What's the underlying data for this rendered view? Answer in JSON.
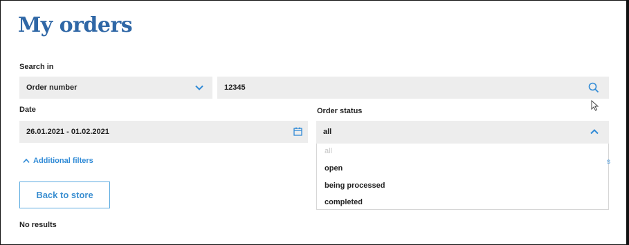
{
  "page": {
    "title": "My orders"
  },
  "search": {
    "label": "Search in",
    "field_value": "Order number",
    "query_value": "12345"
  },
  "date": {
    "label": "Date",
    "value": "26.01.2021 - 01.02.2021"
  },
  "order_status": {
    "label": "Order status",
    "value": "all",
    "options": [
      {
        "label": "all",
        "disabled": true
      },
      {
        "label": "open"
      },
      {
        "label": "being processed"
      },
      {
        "label": "completed"
      }
    ]
  },
  "additional_filters": {
    "label": "Additional filters"
  },
  "back_button": {
    "label": "Back to store"
  },
  "results": {
    "empty_text": "No results"
  },
  "colors": {
    "title": "#2f67a6",
    "accent": "#2f8ad6",
    "field_bg": "#ededed"
  },
  "icons": {
    "select_chevron": "chevron-down-icon",
    "search": "search-icon",
    "calendar": "calendar-icon",
    "status_chevron": "chevron-up-icon",
    "filters_chevron": "chevron-up-icon",
    "cursor": "mouse-cursor-icon"
  }
}
